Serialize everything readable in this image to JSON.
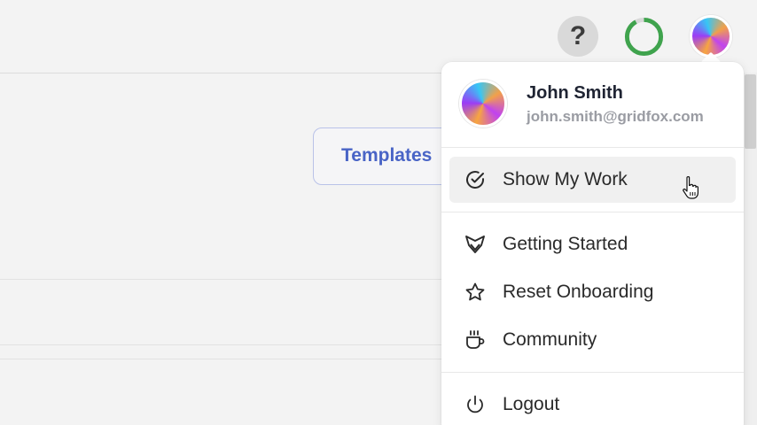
{
  "header": {
    "help_label": "?",
    "progress": 0.92
  },
  "background": {
    "templates_label": "Templates"
  },
  "user_menu": {
    "user": {
      "name": "John Smith",
      "email": "john.smith@gridfox.com"
    },
    "items": [
      {
        "label": "Show My Work",
        "icon": "check-circle-icon",
        "active": true
      },
      {
        "label": "Getting Started",
        "icon": "gridfox-logo-icon"
      },
      {
        "label": "Reset Onboarding",
        "icon": "star-icon"
      },
      {
        "label": "Community",
        "icon": "coffee-cup-icon"
      },
      {
        "label": "Logout",
        "icon": "power-icon"
      }
    ]
  },
  "colors": {
    "accent": "#4964c6",
    "progress_green": "#3fa34d"
  }
}
